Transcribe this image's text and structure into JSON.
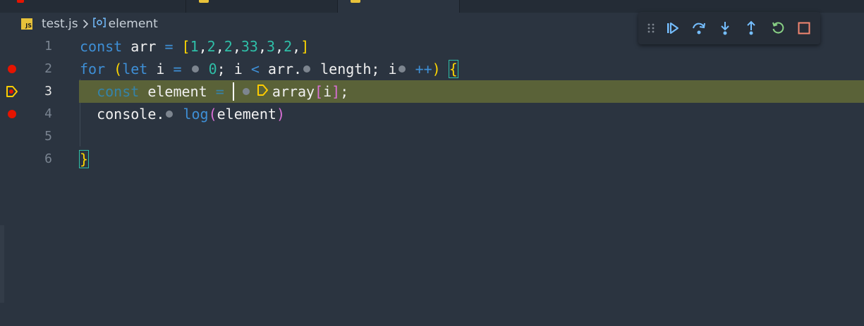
{
  "breadcrumb": {
    "file": "test.js",
    "file_badge": "JS",
    "symbol": "element"
  },
  "editor": {
    "line_numbers": [
      "1",
      "2",
      "3",
      "4",
      "5",
      "6"
    ],
    "current_line": "3"
  },
  "code": {
    "l1": {
      "kw": "const",
      "name": " arr ",
      "eq": "=",
      "sp": " ",
      "open": "[",
      "n1": "1",
      "c1": ",",
      "n2": "2",
      "c2": ",",
      "n3": "2",
      "c3": ",",
      "n4": "33",
      "c4": ",",
      "n5": "3",
      "c5": ",",
      "n6": "2",
      "c6": ",",
      "close": "]"
    },
    "l2": {
      "kw_for": "for",
      "sp": " ",
      "open": "(",
      "kw_let": "let",
      "i1": " i ",
      "eq": "=",
      "zero": "0",
      "semi1": "; i ",
      "lt": "<",
      "arr": " arr.",
      "length": "length; i",
      "inc": "++",
      "close": ")",
      "brace": "{"
    },
    "l3": {
      "kw": "const",
      "name": " element ",
      "eq": "=",
      "sp": " ",
      "array": "array",
      "open": "[",
      "idx": "i",
      "close": "]",
      "semi": ";"
    },
    "l4": {
      "console": "console.",
      "log": "log",
      "open": "(",
      "arg": "element",
      "close": ")"
    },
    "l6": {
      "brace": "}"
    }
  },
  "colors": {
    "breakpoint": "#e51400",
    "current_line_bg": "#5a6238",
    "execution_arrow": "#ffcc00",
    "continue": "#75beff",
    "restart": "#89d185",
    "stop": "#f48771"
  },
  "debug_toolbar": {
    "buttons": [
      "drag-handle-icon",
      "continue-icon",
      "step-over-icon",
      "step-into-icon",
      "step-out-icon",
      "restart-icon",
      "stop-icon"
    ]
  }
}
